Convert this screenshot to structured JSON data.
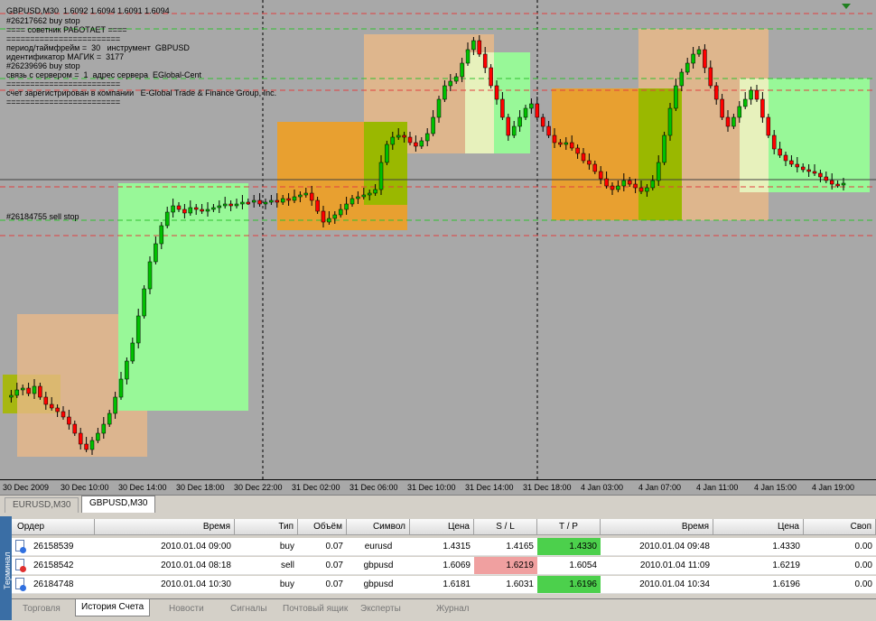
{
  "chart": {
    "header": "GBPUSD,M30  1.6092 1.6094 1.6091 1.6094",
    "lines": [
      "#26217662 buy stop",
      "==== советник РАБОТАЕТ ====",
      "========================",
      "период/таймфрейм =  30   инструмент  GBPUSD",
      "идентификатор МАГИК =  3177",
      "#26239696 buy stop",
      "связь с сервером =  1  адрес сервера  EGlobal-Cent",
      "========================",
      "счет зарегистрирован в компании   E-Global Trade & Finance Group, Inc.",
      "========================"
    ],
    "sell_stop_label": "#26184755 sell stop",
    "time_labels": [
      "30 Dec 2009",
      "30 Dec 10:00",
      "30 Dec 14:00",
      "30 Dec 18:00",
      "30 Dec 22:00",
      "31 Dec 02:00",
      "31 Dec 06:00",
      "31 Dec 10:00",
      "31 Dec 14:00",
      "31 Dec 18:00",
      "4 Jan 03:00",
      "4 Jan 07:00",
      "4 Jan 11:00",
      "4 Jan 15:00",
      "4 Jan 19:00"
    ],
    "colors": {
      "background": "#a8a8a8",
      "bull": "#00c000",
      "bear": "#ff0000",
      "zone_orange": "#e8a040",
      "zone_green": "#98f898"
    }
  },
  "chart_tabs": [
    "EURUSD,M30",
    "GBPUSD,M30"
  ],
  "active_chart_tab": "GBPUSD,M30",
  "terminal_label": "Терминал",
  "table": {
    "headers": [
      "Ордер",
      "Время",
      "Тип",
      "Объём",
      "Символ",
      "Цена",
      "S / L",
      "T / P",
      "Время",
      "Цена",
      "Своп"
    ],
    "rows": [
      {
        "order": "26158539",
        "open_time": "2010.01.04 09:00",
        "type": "buy",
        "volume": "0.07",
        "symbol": "eurusd",
        "price": "1.4315",
        "sl": "1.4165",
        "tp": "1.4330",
        "close_time": "2010.01.04 09:48",
        "close_price": "1.4330",
        "swap": "0.00",
        "status": "tp"
      },
      {
        "order": "26158542",
        "open_time": "2010.01.04 08:18",
        "type": "sell",
        "volume": "0.07",
        "symbol": "gbpusd",
        "price": "1.6069",
        "sl": "1.6219",
        "tp": "1.6054",
        "close_time": "2010.01.04 11:09",
        "close_price": "1.6219",
        "swap": "0.00",
        "status": "sl"
      },
      {
        "order": "26184748",
        "open_time": "2010.01.04 10:30",
        "type": "buy",
        "volume": "0.07",
        "symbol": "gbpusd",
        "price": "1.6181",
        "sl": "1.6031",
        "tp": "1.6196",
        "close_time": "2010.01.04 10:34",
        "close_price": "1.6196",
        "swap": "0.00",
        "status": "tp"
      }
    ]
  },
  "bottom_tabs": [
    "Торговля",
    "История Счета",
    "Новости",
    "Сигналы",
    "Почтовый ящик",
    "Эксперты",
    "Журнал"
  ],
  "active_bottom_tab": "История Счета"
}
